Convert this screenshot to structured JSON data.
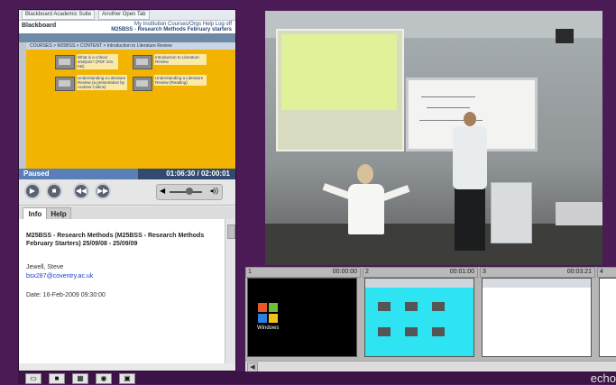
{
  "browser": {
    "tab1": "Blackboard Academic Suite",
    "tab2": "Another Open Tab",
    "logo": "Blackboard",
    "top_right": "My Institution  Courses/Orgs  Help  Log off",
    "course_title": "M25BSS - Research Methods February starters",
    "breadcrumb": "COURSES > M25BSS > CONTENT > Introduction to Literature Review",
    "links": [
      "What is a critical analysis? (PDF 101 KB)",
      "Introduction to Literature Review",
      "Understanding a Literature Review (a presentation by Andrew Collins)",
      "Understanding a Literature Review (Reading)"
    ]
  },
  "player": {
    "status": "Paused",
    "time": "01:06:30 / 02:00:01",
    "progress_fraction": 0.55,
    "volume_fraction": 0.6,
    "icons": [
      "play-icon",
      "stop-icon",
      "rewind-icon",
      "fast-forward-icon",
      "speaker-icon"
    ]
  },
  "tabs": {
    "info": "Info",
    "help": "Help"
  },
  "info": {
    "title": "M25BSS - Research Methods (M25BSS - Research Methods February Starters) 25/09/08 - 25/09/09",
    "presenter": "Jewell, Steve",
    "email": "bsx287@coventry.ac.uk",
    "date": "Date: 16-Feb-2009 09:30:00"
  },
  "slides": [
    {
      "num": "1",
      "time": "00:00:00",
      "kind": "windows",
      "caption": "Windows"
    },
    {
      "num": "2",
      "time": "00:01:00",
      "kind": "cyan"
    },
    {
      "num": "3",
      "time": "00:03:21",
      "kind": "white"
    },
    {
      "num": "4",
      "time": "",
      "kind": "white"
    }
  ],
  "bottom": {
    "buttons": [
      "layout-1-icon",
      "layout-2-icon",
      "grid-icon",
      "zoom-icon",
      "fullscreen-icon"
    ],
    "brand": "echo"
  }
}
